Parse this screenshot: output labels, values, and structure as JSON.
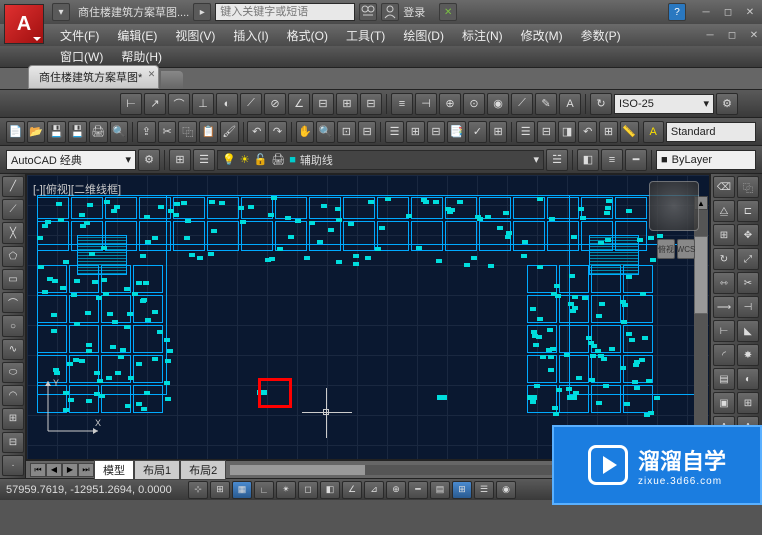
{
  "title_bar": {
    "doc_name": "商住楼建筑方案草图....",
    "search_placeholder": "键入关键字或短语",
    "login_label": "登录"
  },
  "logo_text": "A",
  "menu": {
    "file": "文件(F)",
    "edit": "编辑(E)",
    "view": "视图(V)",
    "insert": "插入(I)",
    "format": "格式(O)",
    "tools": "工具(T)",
    "draw": "绘图(D)",
    "dimension": "标注(N)",
    "modify": "修改(M)",
    "param": "参数(P)",
    "window": "窗口(W)",
    "help": "帮助(H)"
  },
  "file_tab": {
    "name": "商住楼建筑方案草图*"
  },
  "dim_style": "ISO-25",
  "text_style": "Standard",
  "workspace": "AutoCAD 经典",
  "aux_line": "辅助线",
  "layer_prop": "ByLayer",
  "layer_prop_color": "■",
  "view_label": "[-][俯视][二维线框]",
  "layout_tabs": {
    "model": "模型",
    "layout1": "布局1",
    "layout2": "布局2"
  },
  "status": {
    "coords": "57959.7619, -12951.2694, 0.0000",
    "model_label": "模型"
  },
  "navbar": {
    "home": "俯视",
    "wcs": "WCS"
  },
  "watermark": {
    "text": "溜溜自学",
    "sub": "zixue.3d66.com"
  }
}
